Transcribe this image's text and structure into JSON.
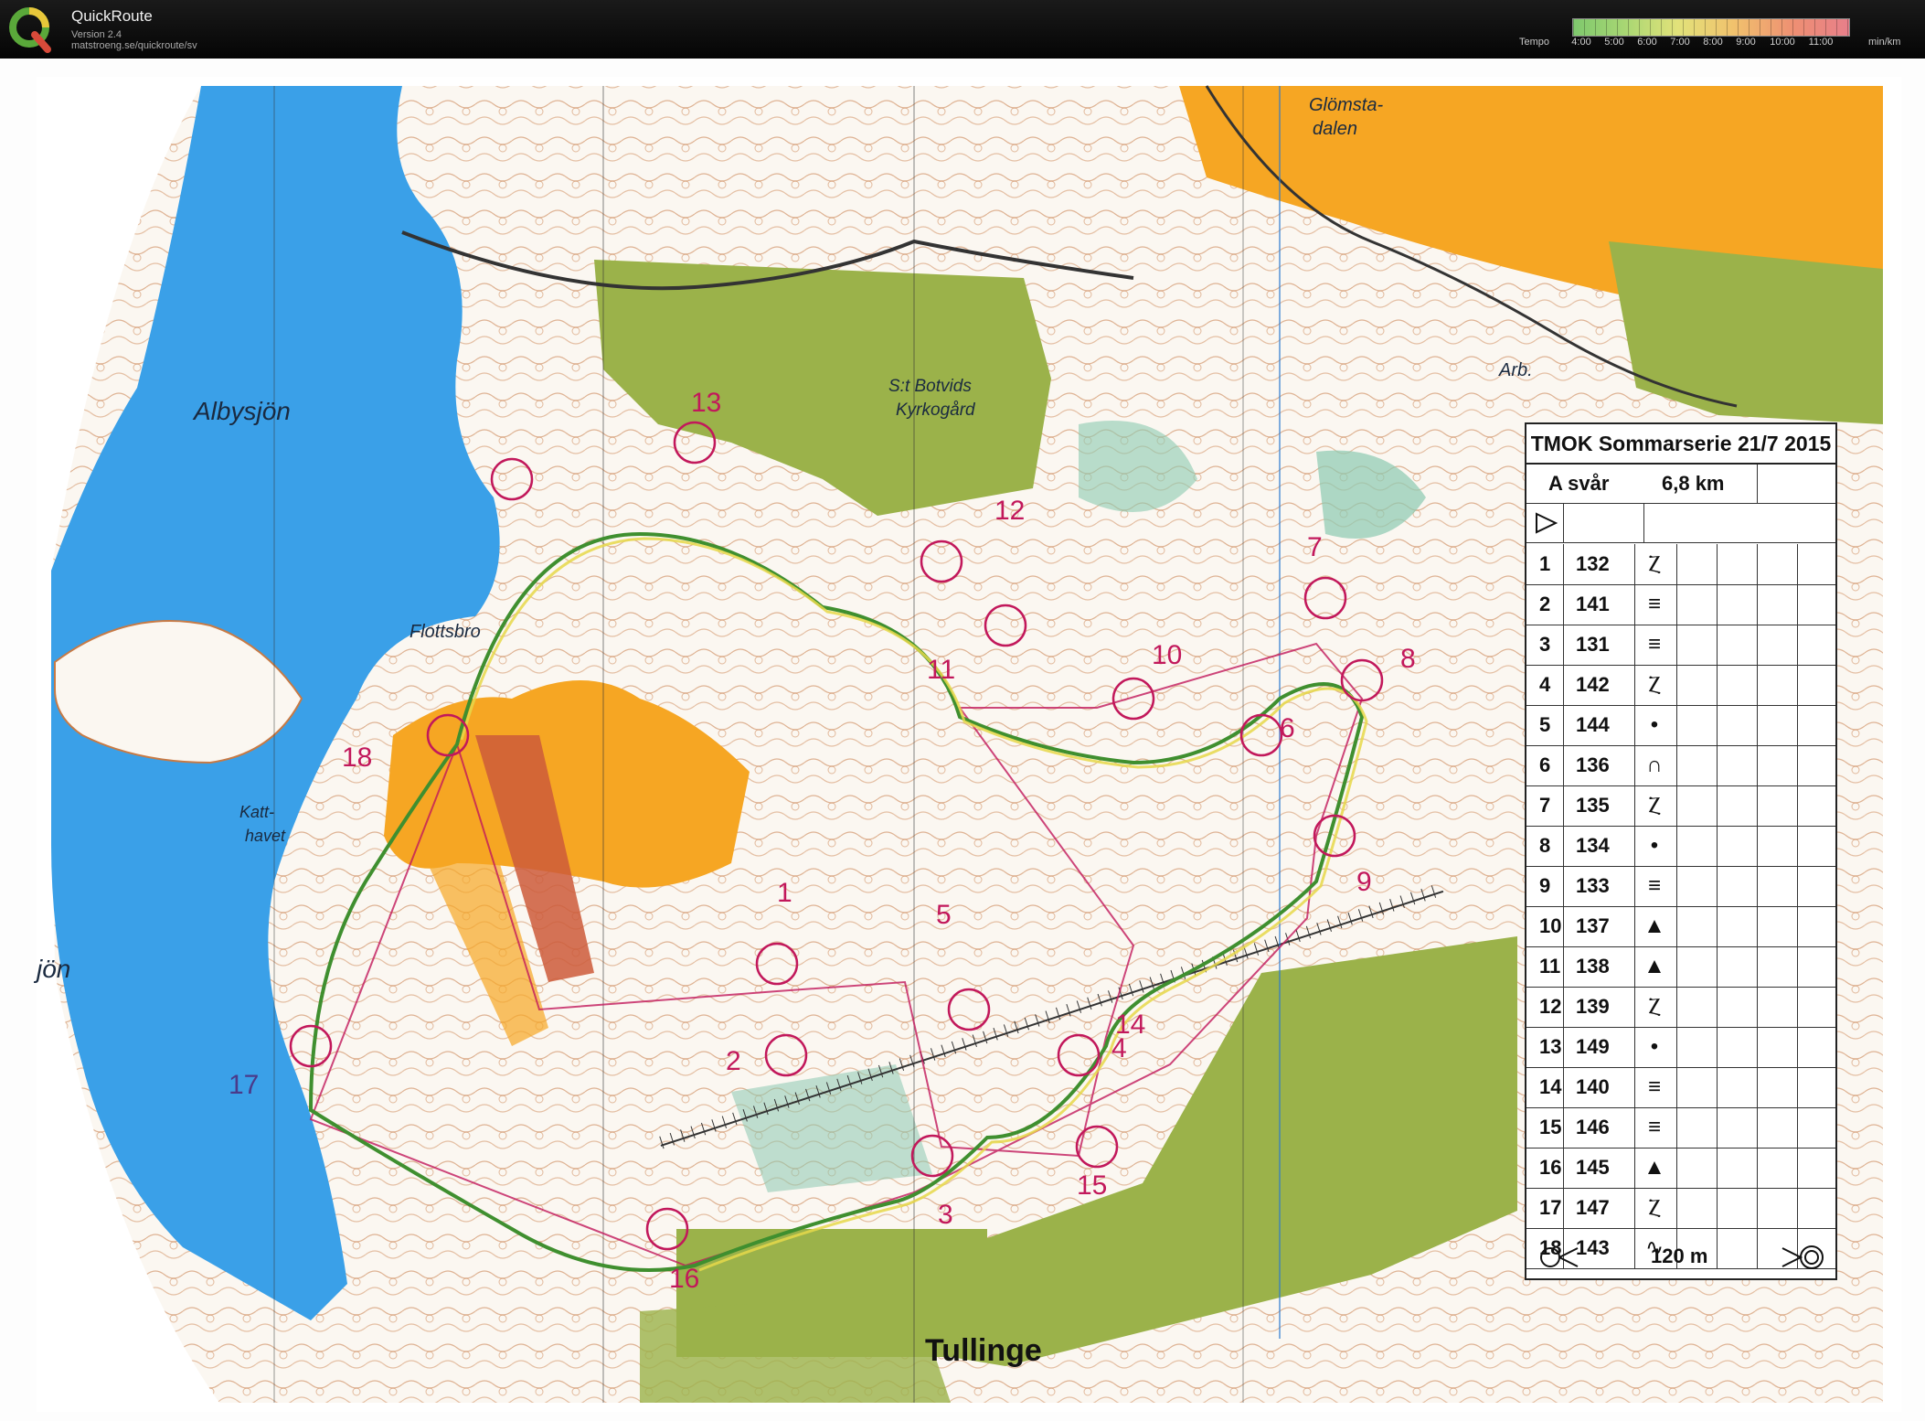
{
  "app": {
    "title": "QuickRoute",
    "version": "Version 2.4",
    "url": "matstroeng.se/quickroute/sv"
  },
  "tempo_legend": {
    "label": "Tempo",
    "ticks": [
      "4:00",
      "5:00",
      "6:00",
      "7:00",
      "8:00",
      "9:00",
      "10:00",
      "11:00"
    ],
    "unit": "min/km",
    "colors": [
      "#7ec86d",
      "#e2e27a",
      "#f1c26d",
      "#e77f8a"
    ]
  },
  "map": {
    "colors": {
      "water": "#3aa0e8",
      "open_land": "#f6a623",
      "settlement": "#9bb24a",
      "contour": "#b8622a",
      "course": "#c2185b",
      "route_green": "#3f8f2f",
      "route_yellow": "#e6d84a"
    },
    "place_names": {
      "albysjon": "Albysjön",
      "jon": "jön",
      "flottsbro": "Flottsbro",
      "katthavet_1": "Katt-",
      "katthavet_2": "havet",
      "glomstadalen_1": "Glömsta-",
      "glomstadalen_2": "dalen",
      "arb": "Arb.",
      "botvid_1": "S:t Botvids",
      "botvid_2": "Kyrkogård",
      "tullinge": "Tullinge"
    },
    "control_numbers": [
      "1",
      "2",
      "3",
      "4",
      "5",
      "6",
      "7",
      "8",
      "9",
      "10",
      "11",
      "12",
      "13",
      "14",
      "15",
      "16",
      "17",
      "18"
    ]
  },
  "control_description": {
    "title": "TMOK Sommarserie 21/7 2015",
    "course": "A svår",
    "length": "6,8 km",
    "start_symbol": "triangle-start-icon",
    "controls": [
      {
        "num": "1",
        "code": "132",
        "symbol": "Ⲍ"
      },
      {
        "num": "2",
        "code": "141",
        "symbol": "≡"
      },
      {
        "num": "3",
        "code": "131",
        "symbol": "≡"
      },
      {
        "num": "4",
        "code": "142",
        "symbol": "Ⲍ"
      },
      {
        "num": "5",
        "code": "144",
        "symbol": "•"
      },
      {
        "num": "6",
        "code": "136",
        "symbol": "∩"
      },
      {
        "num": "7",
        "code": "135",
        "symbol": "Ⲍ"
      },
      {
        "num": "8",
        "code": "134",
        "symbol": "•"
      },
      {
        "num": "9",
        "code": "133",
        "symbol": "≡"
      },
      {
        "num": "10",
        "code": "137",
        "symbol": "▲"
      },
      {
        "num": "11",
        "code": "138",
        "symbol": "▲"
      },
      {
        "num": "12",
        "code": "139",
        "symbol": "Ⲍ"
      },
      {
        "num": "13",
        "code": "149",
        "symbol": "•"
      },
      {
        "num": "14",
        "code": "140",
        "symbol": "≡"
      },
      {
        "num": "15",
        "code": "146",
        "symbol": "≡"
      },
      {
        "num": "16",
        "code": "145",
        "symbol": "▲"
      },
      {
        "num": "17",
        "code": "147",
        "symbol": "Ⲍ"
      },
      {
        "num": "18",
        "code": "143",
        "symbol": "∿"
      }
    ],
    "finish_distance": "120 m"
  }
}
